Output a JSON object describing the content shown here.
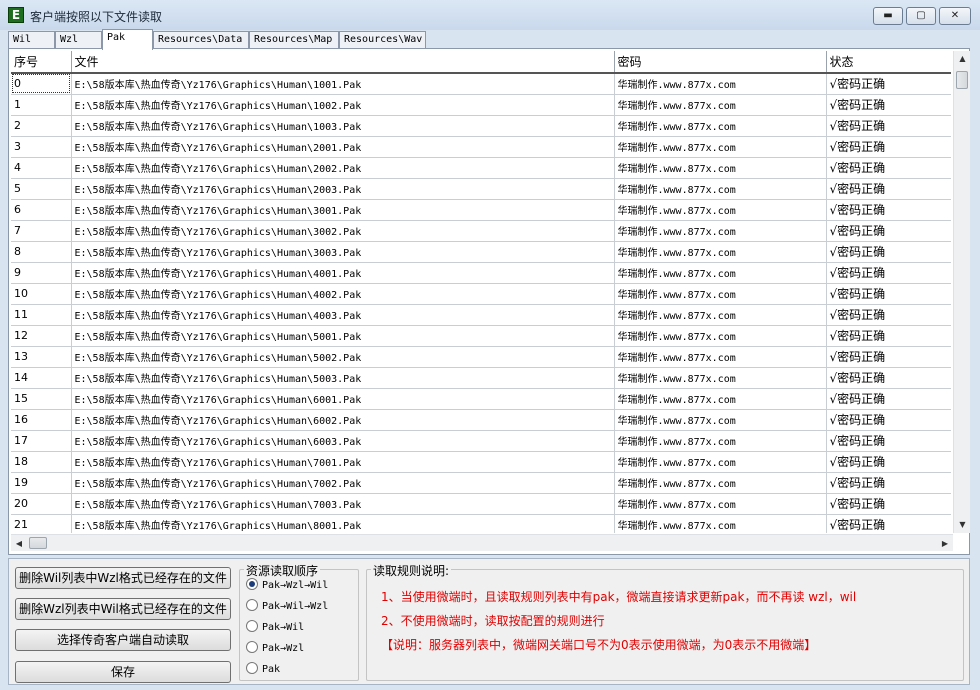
{
  "window": {
    "title": "客户端按照以下文件读取"
  },
  "tabs": [
    {
      "label": "Wil",
      "active": false
    },
    {
      "label": "Wzl",
      "active": false
    },
    {
      "label": "Pak",
      "active": true
    },
    {
      "label": "Resources\\Data",
      "active": false
    },
    {
      "label": "Resources\\Map",
      "active": false
    },
    {
      "label": "Resources\\Wav",
      "active": false
    }
  ],
  "table": {
    "headers": [
      "序号",
      "文件",
      "密码",
      "状态"
    ],
    "rows": [
      [
        "0",
        "E:\\58版本库\\热血传奇\\Yz176\\Graphics\\Human\\1001.Pak",
        "华瑞制作.www.877x.com",
        "√密码正确"
      ],
      [
        "1",
        "E:\\58版本库\\热血传奇\\Yz176\\Graphics\\Human\\1002.Pak",
        "华瑞制作.www.877x.com",
        "√密码正确"
      ],
      [
        "2",
        "E:\\58版本库\\热血传奇\\Yz176\\Graphics\\Human\\1003.Pak",
        "华瑞制作.www.877x.com",
        "√密码正确"
      ],
      [
        "3",
        "E:\\58版本库\\热血传奇\\Yz176\\Graphics\\Human\\2001.Pak",
        "华瑞制作.www.877x.com",
        "√密码正确"
      ],
      [
        "4",
        "E:\\58版本库\\热血传奇\\Yz176\\Graphics\\Human\\2002.Pak",
        "华瑞制作.www.877x.com",
        "√密码正确"
      ],
      [
        "5",
        "E:\\58版本库\\热血传奇\\Yz176\\Graphics\\Human\\2003.Pak",
        "华瑞制作.www.877x.com",
        "√密码正确"
      ],
      [
        "6",
        "E:\\58版本库\\热血传奇\\Yz176\\Graphics\\Human\\3001.Pak",
        "华瑞制作.www.877x.com",
        "√密码正确"
      ],
      [
        "7",
        "E:\\58版本库\\热血传奇\\Yz176\\Graphics\\Human\\3002.Pak",
        "华瑞制作.www.877x.com",
        "√密码正确"
      ],
      [
        "8",
        "E:\\58版本库\\热血传奇\\Yz176\\Graphics\\Human\\3003.Pak",
        "华瑞制作.www.877x.com",
        "√密码正确"
      ],
      [
        "9",
        "E:\\58版本库\\热血传奇\\Yz176\\Graphics\\Human\\4001.Pak",
        "华瑞制作.www.877x.com",
        "√密码正确"
      ],
      [
        "10",
        "E:\\58版本库\\热血传奇\\Yz176\\Graphics\\Human\\4002.Pak",
        "华瑞制作.www.877x.com",
        "√密码正确"
      ],
      [
        "11",
        "E:\\58版本库\\热血传奇\\Yz176\\Graphics\\Human\\4003.Pak",
        "华瑞制作.www.877x.com",
        "√密码正确"
      ],
      [
        "12",
        "E:\\58版本库\\热血传奇\\Yz176\\Graphics\\Human\\5001.Pak",
        "华瑞制作.www.877x.com",
        "√密码正确"
      ],
      [
        "13",
        "E:\\58版本库\\热血传奇\\Yz176\\Graphics\\Human\\5002.Pak",
        "华瑞制作.www.877x.com",
        "√密码正确"
      ],
      [
        "14",
        "E:\\58版本库\\热血传奇\\Yz176\\Graphics\\Human\\5003.Pak",
        "华瑞制作.www.877x.com",
        "√密码正确"
      ],
      [
        "15",
        "E:\\58版本库\\热血传奇\\Yz176\\Graphics\\Human\\6001.Pak",
        "华瑞制作.www.877x.com",
        "√密码正确"
      ],
      [
        "16",
        "E:\\58版本库\\热血传奇\\Yz176\\Graphics\\Human\\6002.Pak",
        "华瑞制作.www.877x.com",
        "√密码正确"
      ],
      [
        "17",
        "E:\\58版本库\\热血传奇\\Yz176\\Graphics\\Human\\6003.Pak",
        "华瑞制作.www.877x.com",
        "√密码正确"
      ],
      [
        "18",
        "E:\\58版本库\\热血传奇\\Yz176\\Graphics\\Human\\7001.Pak",
        "华瑞制作.www.877x.com",
        "√密码正确"
      ],
      [
        "19",
        "E:\\58版本库\\热血传奇\\Yz176\\Graphics\\Human\\7002.Pak",
        "华瑞制作.www.877x.com",
        "√密码正确"
      ],
      [
        "20",
        "E:\\58版本库\\热血传奇\\Yz176\\Graphics\\Human\\7003.Pak",
        "华瑞制作.www.877x.com",
        "√密码正确"
      ],
      [
        "21",
        "E:\\58版本库\\热血传奇\\Yz176\\Graphics\\Human\\8001.Pak",
        "华瑞制作.www.877x.com",
        "√密码正确"
      ]
    ]
  },
  "buttons": {
    "delete_wil": "删除Wil列表中Wzl格式已经存在的文件",
    "delete_wzl": "删除Wzl列表中Wil格式已经存在的文件",
    "auto_read": "选择传奇客户端自动读取",
    "save": "保存"
  },
  "read_order": {
    "label": "资源读取顺序",
    "selected": "Pak→Wzl→Wil",
    "options": [
      "Pak→Wzl→Wil",
      "Pak→Wil→Wzl",
      "Pak→Wil",
      "Pak→Wzl",
      "Pak"
    ]
  },
  "rules": {
    "label": "读取规则说明:",
    "line1": "1、当使用微端时，且读取规则列表中有pak，微端直接请求更新pak，而不再读 wzl，wil",
    "line2": "2、不使用微端时，读取按配置的规则进行",
    "line3": "【说明：服务器列表中，微端网关端口号不为0表示使用微端，为0表示不用微端】"
  },
  "colors": {
    "rule_red": "#e00000",
    "window_bg": "#d8e4f0"
  },
  "icons": {
    "app": "app-e-icon",
    "minimize": "minimize-icon",
    "maximize": "maximize-icon",
    "close": "close-icon"
  }
}
